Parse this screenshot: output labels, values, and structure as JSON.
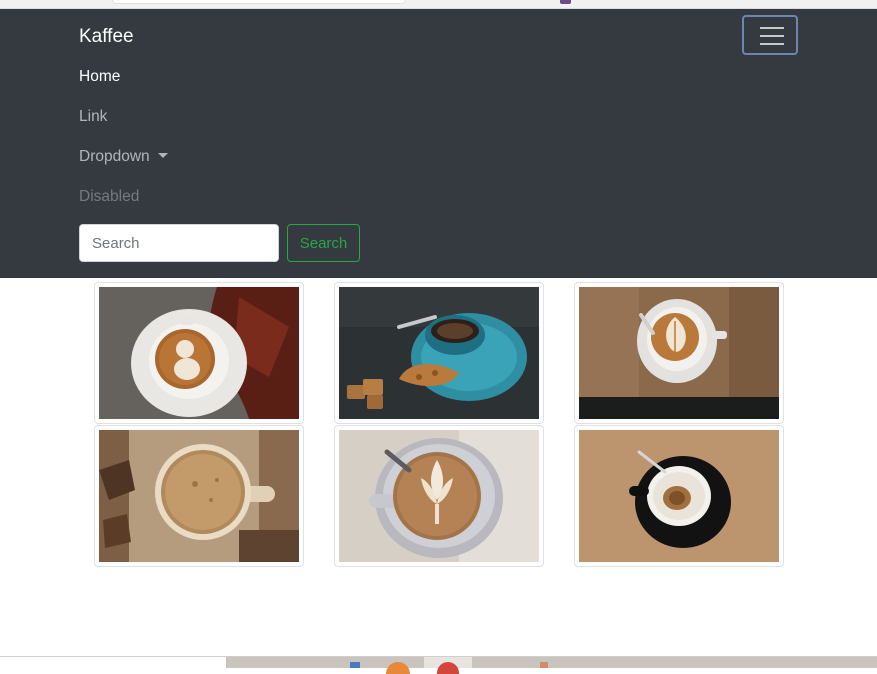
{
  "navbar": {
    "brand": "Kaffee",
    "toggler_icon": "hamburger-menu-icon",
    "links": {
      "home": "Home",
      "link": "Link",
      "dropdown": "Dropdown",
      "disabled": "Disabled"
    },
    "search": {
      "placeholder": "Search",
      "value": "",
      "button": "Search"
    }
  },
  "gallery": {
    "images": [
      {
        "subject": "latte art snowman with autumn leaf"
      },
      {
        "subject": "blue coffee cup with biscotti"
      },
      {
        "subject": "latte art rosetta on wooden table"
      },
      {
        "subject": "top view coffee on rustic wood"
      },
      {
        "subject": "latte art tulip in white cup"
      },
      {
        "subject": "empty espresso cup on black saucer"
      }
    ]
  },
  "colors": {
    "navbar_bg": "#343a40",
    "success": "#28a745",
    "toggler_border": "#6d86b0"
  }
}
